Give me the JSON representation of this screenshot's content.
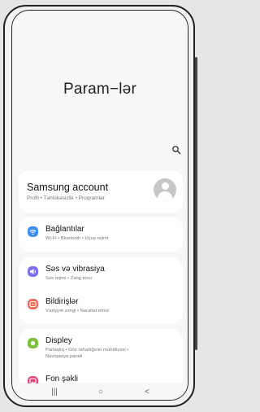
{
  "header": {
    "title": "Param−lər"
  },
  "account": {
    "title": "Samsung account",
    "subtitle": "Profil  •  Təhlükəsizlik  •  Proqramlar"
  },
  "items": [
    {
      "label": "Bağlantılar",
      "sub": "Wi-Fi  •  Bluetooth  •  Uçuş rejimi",
      "icon": "wifi-icon",
      "color": "#3d8ef2"
    },
    {
      "label": "Səs və vibrasiya",
      "sub": "Səs rejimi  •  Zəng tonu",
      "icon": "volume-icon",
      "color": "#7b6ff0"
    },
    {
      "label": "Bildirişlər",
      "sub": "Vəziyyət zəngi  •  Narahat etmə",
      "icon": "notification-icon",
      "color": "#f06a5a"
    },
    {
      "label": "Displey",
      "sub": "Parlaqlıq  •  Göz rahatlığının mühâfizəsi  •",
      "sub2": "Naviqasiya paneli",
      "icon": "brightness-icon",
      "color": "#7cc13a"
    },
    {
      "label": "Fon şəkli",
      "sub": "",
      "icon": "wallpaper-icon",
      "color": "#e2457a"
    }
  ],
  "navbar": {
    "recents": "|||",
    "home": "○",
    "back": "<"
  }
}
